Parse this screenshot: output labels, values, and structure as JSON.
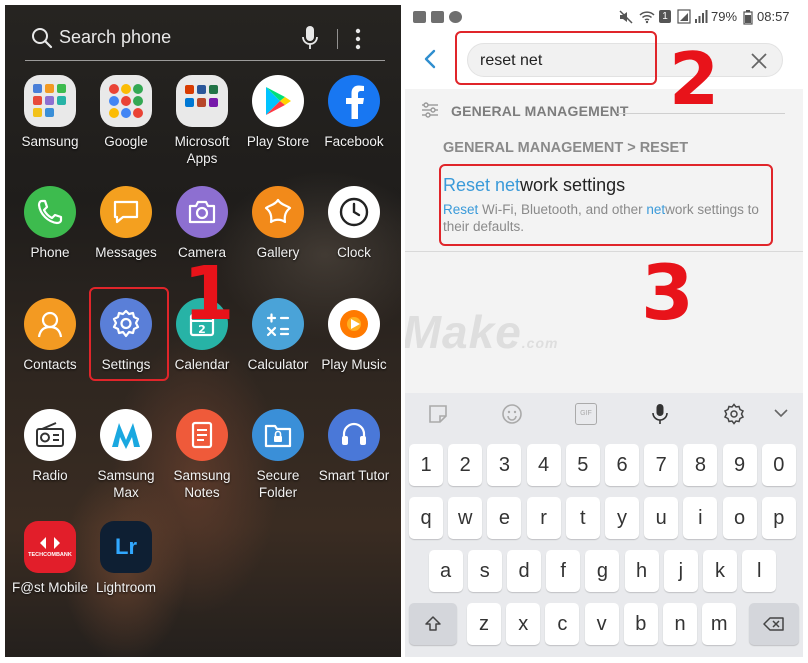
{
  "left_panel": {
    "search_placeholder": "Search phone",
    "apps": [
      {
        "label": "Samsung",
        "icon": "samsung-folder-icon",
        "color": "#eaeaea"
      },
      {
        "label": "Google",
        "icon": "google-folder-icon",
        "color": "#eaeaea"
      },
      {
        "label": "Microsoft Apps",
        "icon": "microsoft-folder-icon",
        "color": "#eaeaea"
      },
      {
        "label": "Play Store",
        "icon": "play-store-icon",
        "color": "#ffffff"
      },
      {
        "label": "Facebook",
        "icon": "facebook-icon",
        "color": "#1877f2"
      },
      {
        "label": "Phone",
        "icon": "phone-icon",
        "color": "#3dbb4e"
      },
      {
        "label": "Messages",
        "icon": "messages-icon",
        "color": "#f4a01f"
      },
      {
        "label": "Camera",
        "icon": "camera-icon",
        "color": "#8d6fd1"
      },
      {
        "label": "Gallery",
        "icon": "gallery-icon",
        "color": "#f28a1a"
      },
      {
        "label": "Clock",
        "icon": "clock-icon",
        "color": "#ffffff"
      },
      {
        "label": "Contacts",
        "icon": "contacts-icon",
        "color": "#f39a22"
      },
      {
        "label": "Settings",
        "icon": "gear-icon",
        "color": "#5a7fd8"
      },
      {
        "label": "Calendar",
        "icon": "calendar-icon",
        "color": "#27b3a6"
      },
      {
        "label": "Calculator",
        "icon": "calculator-icon",
        "color": "#4aa3d8"
      },
      {
        "label": "Play Music",
        "icon": "play-music-icon",
        "color": "#ffffff"
      },
      {
        "label": "Radio",
        "icon": "radio-icon",
        "color": "#ffffff"
      },
      {
        "label": "Samsung Max",
        "icon": "samsung-max-icon",
        "color": "#ffffff"
      },
      {
        "label": "Samsung Notes",
        "icon": "notes-icon",
        "color": "#ef5a3a"
      },
      {
        "label": "Secure Folder",
        "icon": "secure-folder-icon",
        "color": "#3a8fd8"
      },
      {
        "label": "Smart Tutor",
        "icon": "headset-icon",
        "color": "#4a78d8"
      },
      {
        "label": "F@st Mobile",
        "icon": "techcombank-icon",
        "color": "#e21e2a"
      },
      {
        "label": "Lightroom",
        "icon": "lightroom-icon",
        "color": "#0e1f33"
      }
    ],
    "calendar_day": "2",
    "lightroom_text": "Lr",
    "techcombank_text": "TECHCOMBANK",
    "step_number": "1"
  },
  "right_panel": {
    "status": {
      "battery": "79%",
      "time": "08:57",
      "sim_badge": "1"
    },
    "search_value": "reset net",
    "section_header": "GENERAL MANAGEMENT",
    "breadcrumb": "GENERAL MANAGEMENT > RESET",
    "result": {
      "title_hl": "Reset net",
      "title_rest": "work settings",
      "desc_hl1": "Reset",
      "desc_mid1": " Wi-Fi, Bluetooth, and other ",
      "desc_hl2": "net",
      "desc_rest": "work settings to their defaults."
    },
    "step_numbers": [
      "2",
      "3"
    ],
    "keyboard": {
      "row_numbers": [
        "1",
        "2",
        "3",
        "4",
        "5",
        "6",
        "7",
        "8",
        "9",
        "0"
      ],
      "row1": [
        "q",
        "w",
        "e",
        "r",
        "t",
        "y",
        "u",
        "i",
        "o",
        "p"
      ],
      "row2": [
        "a",
        "s",
        "d",
        "f",
        "g",
        "h",
        "j",
        "k",
        "l"
      ],
      "row3": [
        "z",
        "x",
        "c",
        "v",
        "b",
        "n",
        "m"
      ],
      "gif_label": "GIF"
    },
    "accent_color": "#3a9ad9"
  },
  "watermark": {
    "text": "TipsMake",
    "suffix": ".com"
  }
}
